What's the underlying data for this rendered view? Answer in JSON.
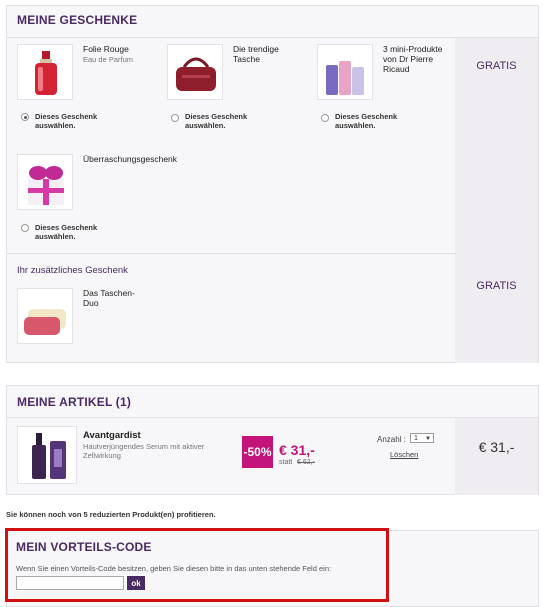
{
  "gifts": {
    "title": "MEINE GESCHENKE",
    "price": "GRATIS",
    "select_label": "Dieses Geschenk auswählen.",
    "items": [
      {
        "name": "Folie Rouge",
        "subtitle": "Eau de Parfum",
        "selected": true
      },
      {
        "name": "Die trendige Tasche",
        "subtitle": "",
        "selected": false
      },
      {
        "name": "3 mini-Produkte von Dr Pierre Ricaud",
        "subtitle": "",
        "selected": false
      },
      {
        "name": "Überraschungsgeschenk",
        "subtitle": "",
        "selected": false
      }
    ],
    "additional": {
      "title": "Ihr zusätzliches Geschenk",
      "item": "Das Taschen-Duo",
      "price": "GRATIS"
    }
  },
  "articles": {
    "title": "MEINE ARTIKEL (1)",
    "item": {
      "name": "Avantgardist",
      "description": "Hautverjüngendes Serum mit aktiver Zellwirkung",
      "discount": "-50%",
      "price": "€ 31,-",
      "old_price_prefix": "statt",
      "old_price": "€ 62,-",
      "quantity_label": "Anzahl :",
      "quantity_value": "1",
      "remove_label": "Löschen",
      "total": "€ 31,-"
    }
  },
  "notice": "Sie können noch von 5 reduzierten Produkt(en) profitieren.",
  "promo": {
    "title": "MEIN VORTEILS-CODE",
    "text": "Wenn Sie einen Vorteils-Code besitzen, geben Sie diesen bitte in das unten stehende Feld ein:",
    "input_value": "",
    "button": "ok"
  },
  "colors": {
    "accent": "#4a2a63",
    "highlight": "#c2147a",
    "promo_border": "#d01010"
  }
}
